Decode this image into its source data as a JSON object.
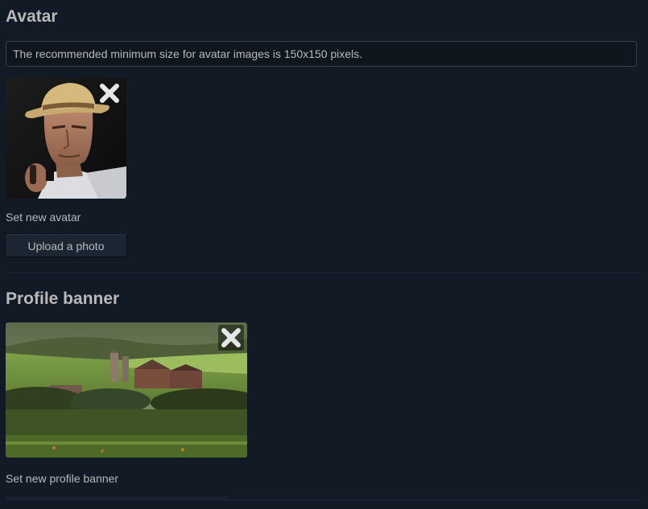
{
  "avatar_section": {
    "heading": "Avatar",
    "info": "The recommended minimum size for avatar images is 150x150 pixels.",
    "set_label": "Set new avatar",
    "upload_label": "Upload a photo",
    "remove_icon": "close-icon"
  },
  "banner_section": {
    "heading": "Profile banner",
    "set_label": "Set new profile banner",
    "remove_icon": "close-icon"
  },
  "colors": {
    "background": "#121a25",
    "text": "#b9b9ba",
    "button": "#1c2633",
    "border": "#39424f"
  }
}
